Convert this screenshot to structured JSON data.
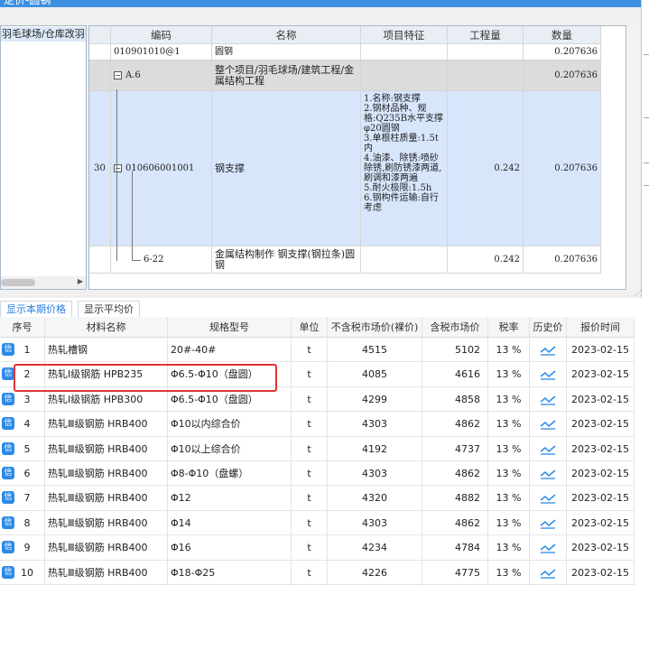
{
  "dialog": {
    "title": "定价-圆钢",
    "tree_node": "羽毛球场/仓库改羽"
  },
  "quota_grid": {
    "headers": [
      "编码",
      "名称",
      "项目特征",
      "工程量",
      "数量"
    ],
    "rows": [
      {
        "seq": "",
        "code": "010901010@1",
        "name": "圆钢",
        "feature": "",
        "qty": "",
        "amount": "0.207636"
      },
      {
        "seq": "",
        "code": "A.6",
        "name": "整个项目/羽毛球场/建筑工程/金属结构工程",
        "feature": "",
        "qty": "",
        "amount": "0.207636"
      },
      {
        "seq": "30",
        "code": "010606001001",
        "name": "钢支撑",
        "feature": "1.名称:钢支撑\n2.钢材品种、规格:Q235B水平支撑φ20圆钢\n3.单根柱质量:1.5t内\n4.油漆、除锈:喷砂除锈,刷防锈漆两道,刷调和漆两遍\n5.耐火极限:1.5h\n6.钢构件运输:自行考虑",
        "qty": "0.242",
        "amount": "0.207636"
      },
      {
        "seq": "",
        "code": "6-22",
        "name": "金属结构制作 钢支撑(钢拉条)圆钢",
        "feature": "",
        "qty": "0.242",
        "amount": "0.207636"
      }
    ]
  },
  "tabs": {
    "current": "显示本期价格",
    "average": "显示平均价"
  },
  "price_table": {
    "headers": [
      "序号",
      "材料名称",
      "规格型号",
      "单位",
      "不含税市场价(裸价)",
      "含税市场价",
      "税率",
      "历史价",
      "报价时间"
    ],
    "badge_label": "信",
    "highlight_color": "#e23434",
    "rows": [
      {
        "no": "1",
        "name": "热轧槽钢",
        "spec": "20#-40#",
        "unit": "t",
        "price_ex": "4515",
        "price_in": "5102",
        "tax": "13 %",
        "date": "2023-02-15"
      },
      {
        "no": "2",
        "name": "热轧Ⅰ级钢筋 HPB235",
        "spec": "Φ6.5-Φ10（盘圆）",
        "unit": "t",
        "price_ex": "4085",
        "price_in": "4616",
        "tax": "13 %",
        "date": "2023-02-15"
      },
      {
        "no": "3",
        "name": "热轧Ⅰ级钢筋 HPB300",
        "spec": "Φ6.5-Φ10（盘圆）",
        "unit": "t",
        "price_ex": "4299",
        "price_in": "4858",
        "tax": "13 %",
        "date": "2023-02-15"
      },
      {
        "no": "4",
        "name": "热轧Ⅲ级钢筋 HRB400",
        "spec": "Φ10以内综合价",
        "unit": "t",
        "price_ex": "4303",
        "price_in": "4862",
        "tax": "13 %",
        "date": "2023-02-15"
      },
      {
        "no": "5",
        "name": "热轧Ⅲ级钢筋 HRB400",
        "spec": "Φ10以上综合价",
        "unit": "t",
        "price_ex": "4192",
        "price_in": "4737",
        "tax": "13 %",
        "date": "2023-02-15"
      },
      {
        "no": "6",
        "name": "热轧Ⅲ级钢筋 HRB400",
        "spec": "Φ8-Φ10（盘螺）",
        "unit": "t",
        "price_ex": "4303",
        "price_in": "4862",
        "tax": "13 %",
        "date": "2023-02-15"
      },
      {
        "no": "7",
        "name": "热轧Ⅲ级钢筋 HRB400",
        "spec": "Φ12",
        "unit": "t",
        "price_ex": "4320",
        "price_in": "4882",
        "tax": "13 %",
        "date": "2023-02-15"
      },
      {
        "no": "8",
        "name": "热轧Ⅲ级钢筋 HRB400",
        "spec": "Φ14",
        "unit": "t",
        "price_ex": "4303",
        "price_in": "4862",
        "tax": "13 %",
        "date": "2023-02-15"
      },
      {
        "no": "9",
        "name": "热轧Ⅲ级钢筋 HRB400",
        "spec": "Φ16",
        "unit": "t",
        "price_ex": "4234",
        "price_in": "4784",
        "tax": "13 %",
        "date": "2023-02-15"
      },
      {
        "no": "10",
        "name": "热轧Ⅲ级钢筋 HRB400",
        "spec": "Φ18-Φ25",
        "unit": "t",
        "price_ex": "4226",
        "price_in": "4775",
        "tax": "13 %",
        "date": "2023-02-15"
      }
    ]
  }
}
